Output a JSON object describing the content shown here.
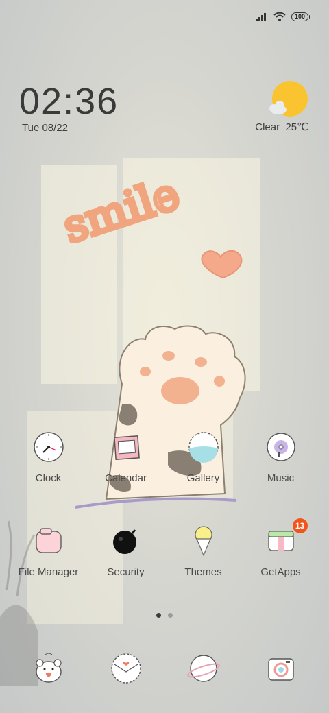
{
  "status_bar": {
    "signal_icon": "signal-icon",
    "wifi_icon": "wifi-icon",
    "battery_level": "100"
  },
  "clock_widget": {
    "time": "02:36",
    "date": "Tue 08/22"
  },
  "weather": {
    "icon": "sun-cloud-icon",
    "condition": "Clear",
    "temperature": "25℃"
  },
  "home_row1": [
    {
      "label": "Clock",
      "icon": "clock-icon"
    },
    {
      "label": "Calendar",
      "icon": "calendar-icon"
    },
    {
      "label": "Gallery",
      "icon": "gallery-icon"
    },
    {
      "label": "Music",
      "icon": "music-icon"
    }
  ],
  "home_row2": [
    {
      "label": "File Manager",
      "icon": "folder-icon"
    },
    {
      "label": "Security",
      "icon": "security-bomb-icon"
    },
    {
      "label": "Themes",
      "icon": "ice-cream-icon"
    },
    {
      "label": "GetApps",
      "icon": "getapps-icon",
      "badge": "13"
    }
  ],
  "page_indicator": {
    "count": 2,
    "active": 0
  },
  "dock": [
    {
      "icon": "phone-hamster-icon"
    },
    {
      "icon": "messages-envelope-icon"
    },
    {
      "icon": "browser-planet-icon"
    },
    {
      "icon": "camera-icon"
    }
  ],
  "wallpaper": {
    "text": "smile",
    "accent": "#f0a57e",
    "paw_pad": "#f2b28f"
  }
}
